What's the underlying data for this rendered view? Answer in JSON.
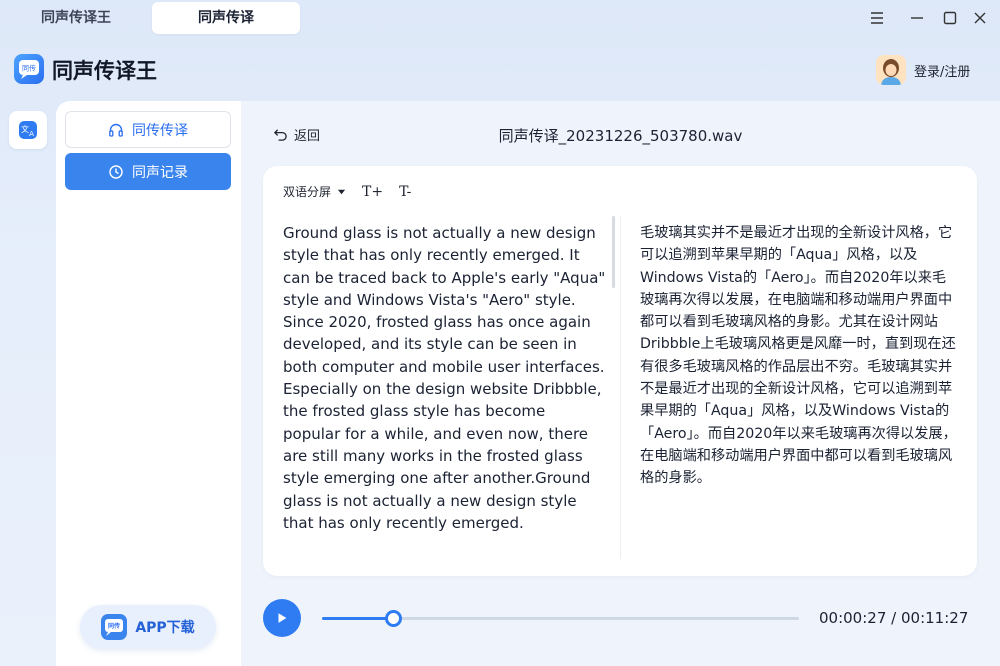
{
  "tabs": [
    {
      "label": "同声传译王",
      "active": false
    },
    {
      "label": "同声传译",
      "active": true
    }
  ],
  "window_controls": [
    "menu-icon",
    "minimize-icon",
    "maximize-icon",
    "close-icon"
  ],
  "header": {
    "app_name": "同声传译王",
    "logo_text": "同传",
    "login_label": "登录/注册"
  },
  "sidebar": {
    "items": [
      {
        "label": "同传传译",
        "icon": "headphones-icon",
        "selected": false
      },
      {
        "label": "同声记录",
        "icon": "clock-icon",
        "selected": true
      }
    ],
    "download_label": "APP下载"
  },
  "main": {
    "back_label": "返回",
    "file_name": "同声传译_20231226_503780.wav",
    "view_mode": "双语分屏",
    "font_increase": "T+",
    "font_decrease": "T-",
    "source_text": "Ground glass is not actually a new design style that has only recently emerged. It can be traced back to Apple's early \"Aqua\" style and Windows Vista's \"Aero\" style. Since 2020, frosted glass has once again developed, and its style can be seen in both computer and mobile user interfaces. Especially on the design website Dribbble, the frosted glass style has become popular for a while, and even now, there are still many works in the frosted glass style emerging one after another.Ground glass is not actually a new design style that has only recently emerged.",
    "translated_text": "毛玻璃其实并不是最近才出现的全新设计风格，它可以追溯到苹果早期的「Aqua」风格，以及Windows Vista的「Aero」。而自2020年以来毛玻璃再次得以发展，在电脑端和移动端用户界面中都可以看到毛玻璃风格的身影。尤其在设计网站Dribbble上毛玻璃风格更是风靡一时，直到现在还有很多毛玻璃风格的作品层出不穷。毛玻璃其实并不是最近才出现的全新设计风格，它可以追溯到苹果早期的「Aqua」风格，以及Windows Vista的「Aero」。而自2020年以来毛玻璃再次得以发展，在电脑端和移动端用户界面中都可以看到毛玻璃风格的身影。"
  },
  "player": {
    "current_time": "00:00:27",
    "separator": "/",
    "total_time": "00:11:27",
    "progress": 0.15
  },
  "colors": {
    "accent": "#2f7cf2",
    "selected_nav": "#3a84ee"
  }
}
